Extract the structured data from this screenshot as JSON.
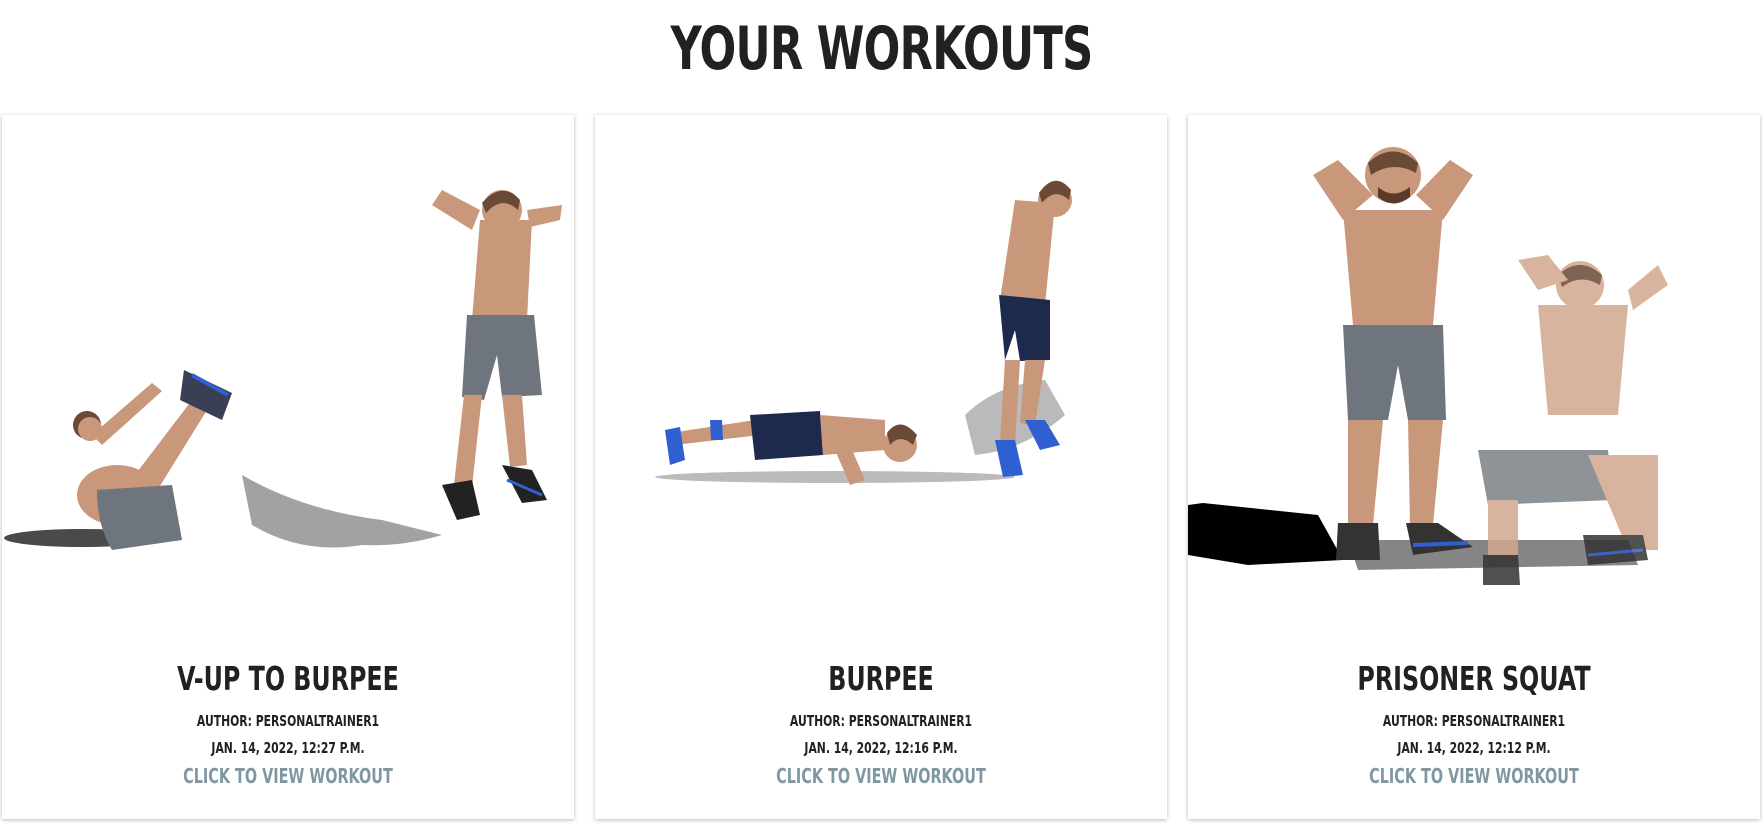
{
  "page": {
    "title": "YOUR WORKOUTS"
  },
  "colors": {
    "text": "#212121",
    "link": "#7f97a2",
    "shorts_grey": "#6e757c",
    "shorts_navy": "#1d2a4d",
    "skin": "#c9977a",
    "shoes_blue": "#2f5fd0"
  },
  "workouts": [
    {
      "title": "V-UP TO BURPEE",
      "author": "AUTHOR: PERSONALTRAINER1",
      "date": "JAN. 14, 2022, 12:27 P.M.",
      "link": "CLICK TO VIEW WORKOUT",
      "image_icon": "v-up-to-burpee-photo"
    },
    {
      "title": "BURPEE",
      "author": "AUTHOR: PERSONALTRAINER1",
      "date": "JAN. 14, 2022, 12:16 P.M.",
      "link": "CLICK TO VIEW WORKOUT",
      "image_icon": "burpee-photo"
    },
    {
      "title": "PRISONER SQUAT",
      "author": "AUTHOR: PERSONALTRAINER1",
      "date": "JAN. 14, 2022, 12:12 P.M.",
      "link": "CLICK TO VIEW WORKOUT",
      "image_icon": "prisoner-squat-photo"
    }
  ]
}
